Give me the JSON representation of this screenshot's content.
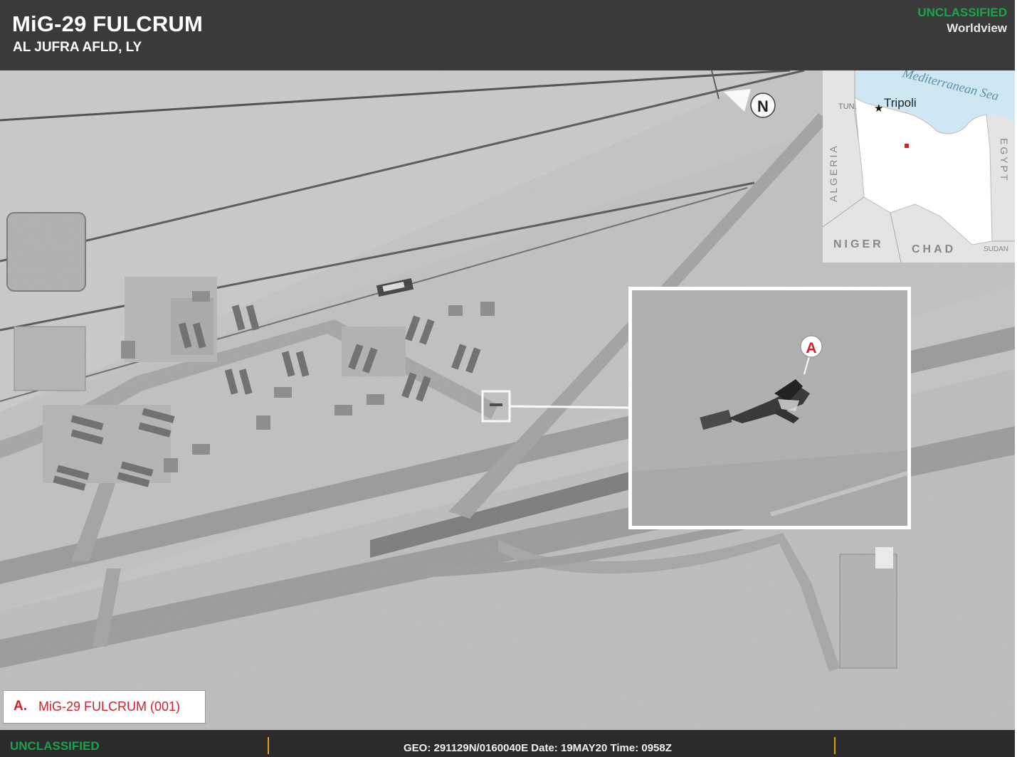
{
  "header": {
    "title": "MiG-29 FULCRUM",
    "subtitle": "AL JUFRA AFLD, LY",
    "classification": "UNCLASSIFIED",
    "source": "Worldview"
  },
  "north_arrow": {
    "label": "N"
  },
  "inset_map": {
    "sea_label": "Mediterranean Sea",
    "city": "Tripoli",
    "countries": {
      "tunisia": "TUN.",
      "algeria": "ALGERIA",
      "egypt": "EGYPT",
      "niger": "NIGER",
      "chad": "CHAD",
      "sudan": "SUDAN"
    },
    "marker_color": "#d3202a"
  },
  "callout": {
    "marker": "A"
  },
  "legend": {
    "key": "A.",
    "text": "MiG-29 FULCRUM (001)"
  },
  "footer": {
    "classification": "UNCLASSIFIED",
    "geo_line": "GEO: 291129N/0160040E Date: 19MAY20  Time: 0958Z"
  },
  "colors": {
    "classification_green": "#1aa34a",
    "annotation_red": "#d3202a",
    "separator_amber": "#e2a300"
  }
}
